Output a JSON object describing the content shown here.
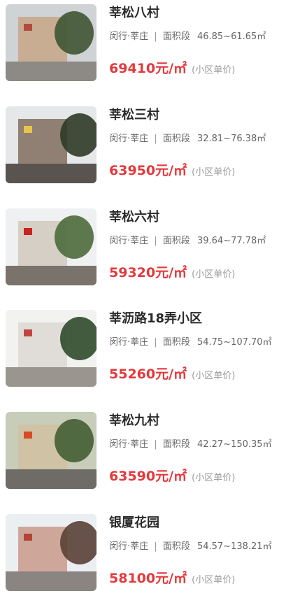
{
  "listings": [
    {
      "name": "莘松八村",
      "district": "闵行·莘庄",
      "separator": "|",
      "area_label": "面积段",
      "area_range": "46.85~61.65㎡",
      "price": "69410元/㎡",
      "price_note": "(小区单价)",
      "photo": {
        "sky": "#cfd3d6",
        "building": "#c9ad93",
        "tree": "#3f5533",
        "road": "#8d8a85",
        "accent": "#b24a3d"
      }
    },
    {
      "name": "莘松三村",
      "district": "闵行·莘庄",
      "separator": "|",
      "area_label": "面积段",
      "area_range": "32.81~76.38㎡",
      "price": "63950元/㎡",
      "price_note": "(小区单价)",
      "photo": {
        "sky": "#e5e7e8",
        "building": "#8f8073",
        "tree": "#2d3a27",
        "road": "#5a5450",
        "accent": "#e8c54a"
      }
    },
    {
      "name": "莘松六村",
      "district": "闵行·莘庄",
      "separator": "|",
      "area_label": "面积段",
      "area_range": "39.64~77.78㎡",
      "price": "59320元/㎡",
      "price_note": "(小区单价)",
      "photo": {
        "sky": "#eef0f2",
        "building": "#d6cfc6",
        "tree": "#4d6a3a",
        "road": "#7a736b",
        "accent": "#c8231f"
      }
    },
    {
      "name": "莘沥路18弄小区",
      "district": "闵行·莘庄",
      "separator": "|",
      "area_label": "面积段",
      "area_range": "54.75~107.70㎡",
      "price": "55260元/㎡",
      "price_note": "(小区单价)",
      "photo": {
        "sky": "#f2f2f0",
        "building": "#e0ddd8",
        "tree": "#2f4a2a",
        "road": "#9a958f",
        "accent": "#c2463f"
      }
    },
    {
      "name": "莘松九村",
      "district": "闵行·莘庄",
      "separator": "|",
      "area_label": "面积段",
      "area_range": "42.27~150.35㎡",
      "price": "63590元/㎡",
      "price_note": "(小区单价)",
      "photo": {
        "sky": "#c7cdb9",
        "building": "#cfc2a5",
        "tree": "#445e34",
        "road": "#6f6b67",
        "accent": "#d74a25"
      }
    },
    {
      "name": "银厦花园",
      "district": "闵行·莘庄",
      "separator": "|",
      "area_label": "面积段",
      "area_range": "54.57~138.21㎡",
      "price": "58100元/㎡",
      "price_note": "(小区单价)",
      "photo": {
        "sky": "#eceff2",
        "building": "#cfa79a",
        "tree": "#5a3f35",
        "road": "#8a8580",
        "accent": "#b24536"
      }
    }
  ]
}
